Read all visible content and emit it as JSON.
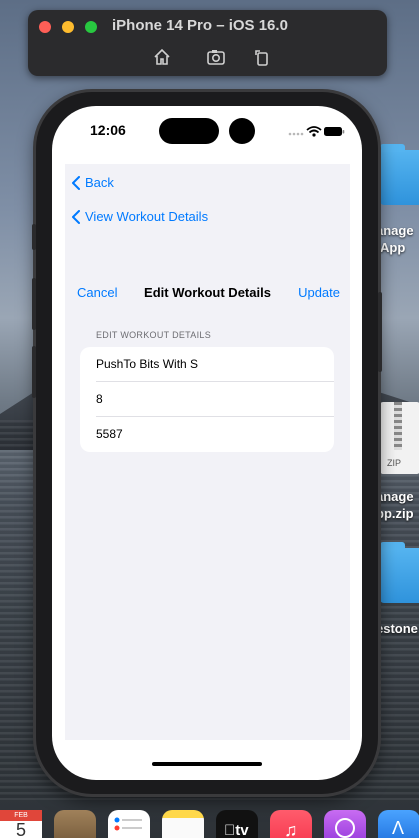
{
  "simulator": {
    "title": "iPhone 14 Pro – iOS 16.0",
    "tools": [
      "home-icon",
      "screenshot-icon",
      "rotate-icon"
    ]
  },
  "desktop": {
    "items": [
      {
        "label_line1": "anage",
        "label_line2": "App",
        "type": "folder"
      },
      {
        "label_line1": "anage",
        "label_line2": "pp.zip",
        "type": "zip",
        "zip_text": "ZIP"
      },
      {
        "label_line1": "estone",
        "type": "folder"
      }
    ]
  },
  "dock": {
    "calendar_month": "FEB",
    "calendar_day": "5",
    "apps": [
      "calendar-icon",
      "passwords-icon",
      "reminders-icon",
      "notes-icon",
      "tv-icon",
      "music-icon",
      "podcasts-icon",
      "xcode-icon"
    ],
    "tv_label": "tv"
  },
  "status_bar": {
    "time": "12:06"
  },
  "navigation": {
    "back_label": "Back",
    "view_workout_label": "View Workout Details"
  },
  "form": {
    "cancel_label": "Cancel",
    "title": "Edit Workout Details",
    "update_label": "Update",
    "section_header": "EDIT WORKOUT DETAILS",
    "fields": [
      {
        "value": "PushTo Bits With S"
      },
      {
        "value": "8"
      },
      {
        "value": "5587"
      }
    ]
  },
  "colors": {
    "accent": "#007aff",
    "grouped_background": "#f2f2f7"
  }
}
